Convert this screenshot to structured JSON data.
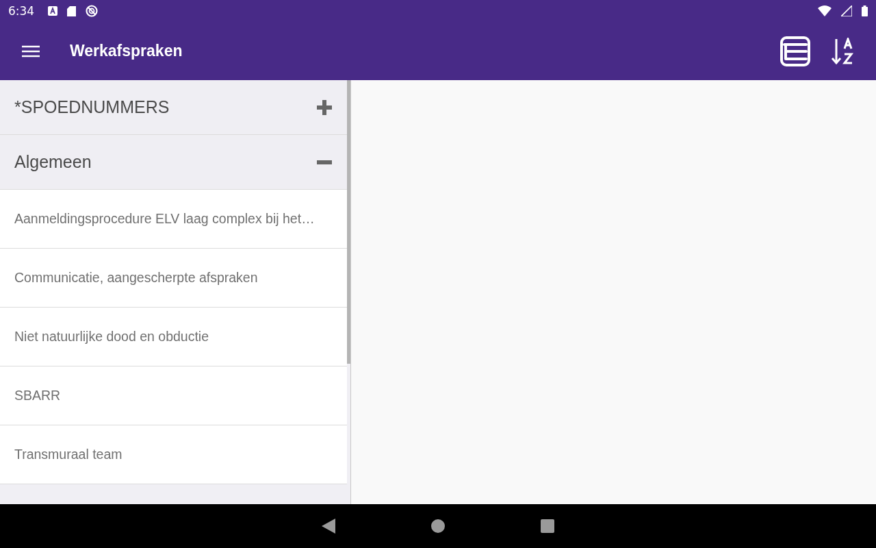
{
  "status_bar": {
    "time": "6:34"
  },
  "app_bar": {
    "title": "Werkafspraken"
  },
  "groups": [
    {
      "title": "*SPOEDNUMMERS",
      "expanded": false
    },
    {
      "title": "Algemeen",
      "expanded": true,
      "children": [
        {
          "label": "Aanmeldingsprocedure ELV laag complex bij het…"
        },
        {
          "label": "Communicatie, aangescherpte afspraken"
        },
        {
          "label": "Niet natuurlijke dood en obductie"
        },
        {
          "label": "SBARR"
        },
        {
          "label": "Transmuraal team"
        }
      ]
    }
  ]
}
